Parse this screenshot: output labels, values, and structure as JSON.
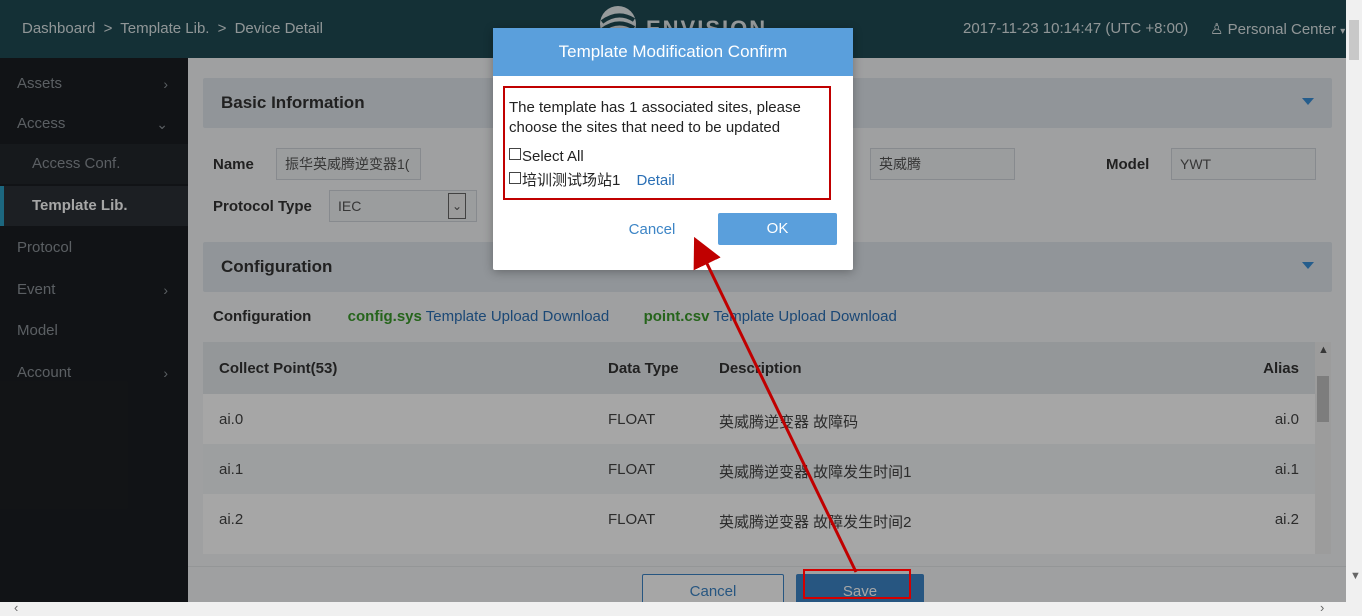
{
  "header": {
    "breadcrumb": [
      "Dashboard",
      ">",
      "Template Lib.",
      ">",
      "Device Detail"
    ],
    "logo_text": "ENVISION",
    "datetime": "2017-11-23 10:14:47 (UTC +8:00)",
    "personal_center": "Personal Center"
  },
  "sidebar": {
    "items": [
      {
        "label": "Assets"
      },
      {
        "label": "Access"
      },
      {
        "label": "Access Conf."
      },
      {
        "label": "Template Lib."
      },
      {
        "label": "Protocol"
      },
      {
        "label": "Event"
      },
      {
        "label": "Model"
      },
      {
        "label": "Account"
      }
    ]
  },
  "basic_info": {
    "title": "Basic Information",
    "name_label": "Name",
    "name_value": "振华英威腾逆变器1(",
    "manufacturer_value": "英威腾",
    "model_label": "Model",
    "model_value": "YWT",
    "protocol_label": "Protocol Type",
    "protocol_value": "IEC"
  },
  "configuration": {
    "title": "Configuration",
    "row_label": "Configuration",
    "file1": "config.sys",
    "file2": "point.csv",
    "template": "Template",
    "upload": "Upload",
    "download": "Download"
  },
  "table": {
    "headers": [
      "Collect Point(53)",
      "Data Type",
      "Description",
      "Alias"
    ],
    "rows": [
      [
        "ai.0",
        "FLOAT",
        "英威腾逆变器 故障码",
        "ai.0"
      ],
      [
        "ai.1",
        "FLOAT",
        "英威腾逆变器 故障发生时间1",
        "ai.1"
      ],
      [
        "ai.2",
        "FLOAT",
        "英威腾逆变器 故障发生时间2",
        "ai.2"
      ]
    ]
  },
  "footer": {
    "cancel": "Cancel",
    "save": "Save"
  },
  "modal": {
    "title": "Template Modification Confirm",
    "message": "The template has 1 associated sites, please choose the sites that need to be updated",
    "select_all": "Select All",
    "site_name": "培训测试场站1",
    "detail": "Detail",
    "cancel": "Cancel",
    "ok": "OK"
  },
  "colors": {
    "header_bg": "#1f4a53",
    "sidebar_bg": "#1b1e22",
    "accent": "#3d85c6",
    "modal_head": "#5a9fdc",
    "annotation_red": "#c00000"
  }
}
